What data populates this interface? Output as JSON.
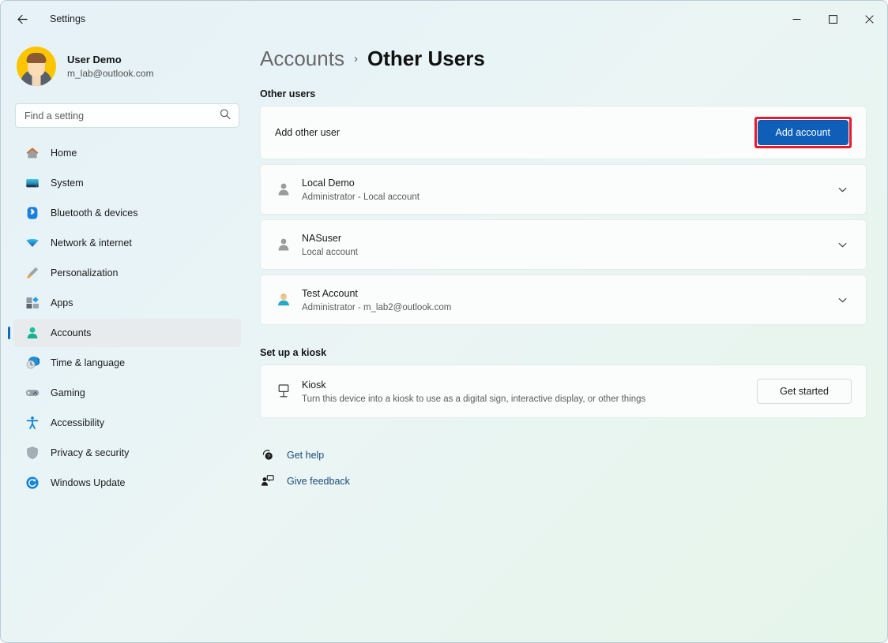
{
  "window": {
    "title": "Settings",
    "back_label": "back-arrow",
    "controls": {
      "minimize": "minimize",
      "maximize": "maximize",
      "close": "close"
    }
  },
  "sidebar": {
    "profile": {
      "name": "User Demo",
      "email": "m_lab@outlook.com"
    },
    "search": {
      "placeholder": "Find a setting",
      "value": ""
    },
    "items": [
      {
        "label": "Home",
        "icon": "home-icon",
        "selected": false
      },
      {
        "label": "System",
        "icon": "system-icon",
        "selected": false
      },
      {
        "label": "Bluetooth & devices",
        "icon": "bluetooth-icon",
        "selected": false
      },
      {
        "label": "Network & internet",
        "icon": "network-icon",
        "selected": false
      },
      {
        "label": "Personalization",
        "icon": "personalization-icon",
        "selected": false
      },
      {
        "label": "Apps",
        "icon": "apps-icon",
        "selected": false
      },
      {
        "label": "Accounts",
        "icon": "accounts-icon",
        "selected": true
      },
      {
        "label": "Time & language",
        "icon": "time-language-icon",
        "selected": false
      },
      {
        "label": "Gaming",
        "icon": "gaming-icon",
        "selected": false
      },
      {
        "label": "Accessibility",
        "icon": "accessibility-icon",
        "selected": false
      },
      {
        "label": "Privacy & security",
        "icon": "privacy-security-icon",
        "selected": false
      },
      {
        "label": "Windows Update",
        "icon": "windows-update-icon",
        "selected": false
      }
    ]
  },
  "main": {
    "breadcrumb": {
      "parent": "Accounts",
      "separator": "›",
      "current": "Other Users"
    },
    "other_users": {
      "section_label": "Other users",
      "add_user": {
        "label": "Add other user",
        "button": "Add account",
        "highlighted": true
      },
      "accounts": [
        {
          "name": "Local Demo",
          "detail": "Administrator - Local account",
          "avatar": "generic-user-icon"
        },
        {
          "name": "NASuser",
          "detail": "Local account",
          "avatar": "generic-user-icon"
        },
        {
          "name": "Test Account",
          "detail": "Administrator - m_lab2@outlook.com",
          "avatar": "photo-user-icon"
        }
      ]
    },
    "kiosk": {
      "section_label": "Set up a kiosk",
      "title": "Kiosk",
      "description": "Turn this device into a kiosk to use as a digital sign, interactive display, or other things",
      "button": "Get started"
    },
    "footer_links": [
      {
        "label": "Get help",
        "icon": "get-help-icon"
      },
      {
        "label": "Give feedback",
        "icon": "give-feedback-icon"
      }
    ]
  },
  "colors": {
    "accent": "#0f6cbd",
    "primary_button": "#0f5fb9",
    "highlight_border": "#e8192c",
    "link": "#1b4c7e"
  }
}
